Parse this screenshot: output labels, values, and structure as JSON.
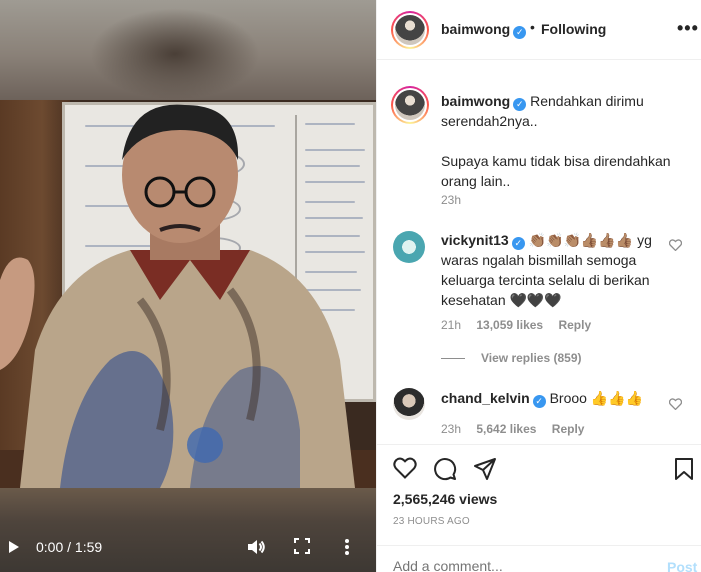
{
  "video": {
    "time": "0:00 / 1:59"
  },
  "header": {
    "username": "baimwong",
    "verified_mark": "✓",
    "separator": "•",
    "follow_status": "Following",
    "menu": "•••"
  },
  "caption": {
    "username": "baimwong",
    "text_line1": "Rendahkan dirimu",
    "text_line2": "serendah2nya..",
    "text_para2": "Supaya kamu tidak bisa direndahkan orang lain..",
    "time": "23h"
  },
  "comments": [
    {
      "username": "vickynit13",
      "text": "👏🏽👏🏽👏🏽👍🏽👍🏽👍🏽 yg waras ngalah bismillah semoga keluarga tercinta selalu di berikan kesehatan 🖤🖤🖤",
      "time": "21h",
      "likes": "13,059 likes",
      "reply": "Reply",
      "view_replies": "View replies (859)"
    },
    {
      "username": "chand_kelvin",
      "text": "Brooo 👍👍👍",
      "time": "23h",
      "likes": "5,642 likes",
      "reply": "Reply"
    }
  ],
  "stats": {
    "views": "2,565,246 views",
    "age": "23 HOURS AGO"
  },
  "add_comment": {
    "placeholder": "Add a comment...",
    "post_label": "Post"
  },
  "colors": {
    "verified": "#3897f0",
    "post_disabled": "#b2dffc",
    "muted": "#8e8e8e"
  }
}
